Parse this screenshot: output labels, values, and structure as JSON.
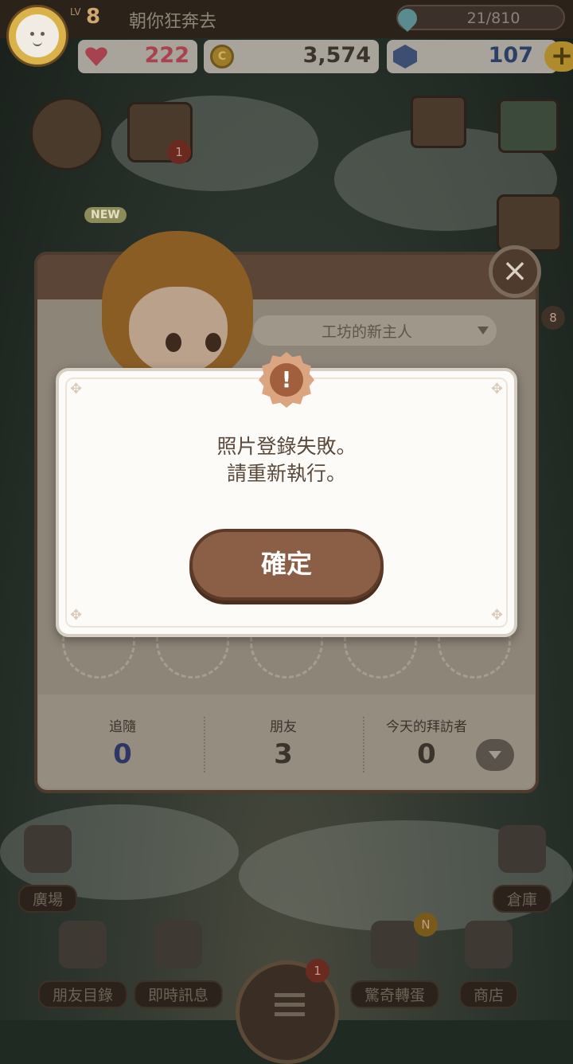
{
  "hud": {
    "level_label": "LV",
    "level": "8",
    "username": "朝你狂奔去",
    "energy": "21/810",
    "hearts": "222",
    "coins": "3,574",
    "gems": "107",
    "plus": "+",
    "colors": {
      "hearts": "#a8424e",
      "coins": "#3b342d",
      "gems": "#2c3f66"
    }
  },
  "side": {
    "new_badge": "NEW",
    "calendar_badge": "1",
    "right_badge": "8"
  },
  "profile": {
    "title": "工坊的新主人",
    "close": "×",
    "stats": [
      {
        "label": "追隨",
        "value": "0",
        "color": "#2f3666"
      },
      {
        "label": "朋友",
        "value": "3",
        "color": "#3b342d"
      },
      {
        "label": "今天的拜訪者",
        "value": "0",
        "color": "#3b342d"
      }
    ]
  },
  "dialog": {
    "icon": "!",
    "line1": "照片登錄失敗。",
    "line2": "請重新執行。",
    "confirm": "確定"
  },
  "nav": {
    "plaza": "廣場",
    "warehouse": "倉庫",
    "friends": "朋友目錄",
    "messages": "即時訊息",
    "gacha": "驚奇轉蛋",
    "shop": "商店",
    "center_badge": "1",
    "gacha_badge": "N"
  }
}
